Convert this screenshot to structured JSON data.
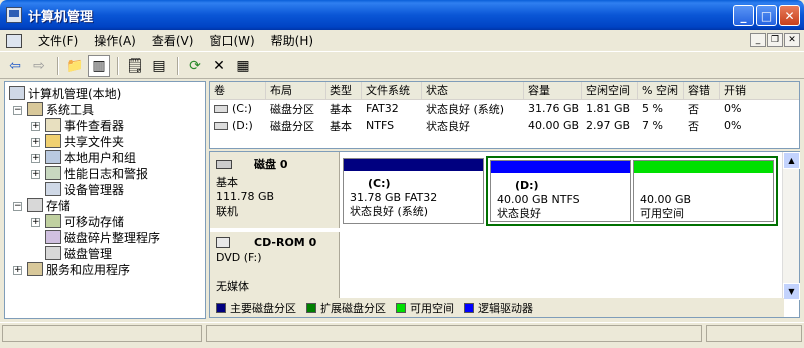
{
  "window": {
    "title": "计算机管理"
  },
  "menu": [
    "文件(F)",
    "操作(A)",
    "查看(V)",
    "窗口(W)",
    "帮助(H)"
  ],
  "tree": {
    "root": "计算机管理(本地)",
    "system_tools": "系统工具",
    "event_viewer": "事件查看器",
    "shared_folders": "共享文件夹",
    "local_users": "本地用户和组",
    "perf_logs": "性能日志和警报",
    "device_manager": "设备管理器",
    "storage": "存储",
    "removable": "可移动存储",
    "defrag": "磁盘碎片整理程序",
    "disk_mgmt": "磁盘管理",
    "services": "服务和应用程序"
  },
  "list": {
    "columns": [
      "卷",
      "布局",
      "类型",
      "文件系统",
      "状态",
      "容量",
      "空闲空间",
      "% 空闲",
      "容错",
      "开销"
    ],
    "rows": [
      [
        "(C:)",
        "磁盘分区",
        "基本",
        "FAT32",
        "状态良好 (系统)",
        "31.76 GB",
        "1.81 GB",
        "5 %",
        "否",
        "0%"
      ],
      [
        "(D:)",
        "磁盘分区",
        "基本",
        "NTFS",
        "状态良好",
        "40.00 GB",
        "2.97 GB",
        "7 %",
        "否",
        "0%"
      ]
    ]
  },
  "disk0": {
    "name": "磁盘 0",
    "type": "基本",
    "size": "111.78 GB",
    "status": "联机",
    "partitions": [
      {
        "label": "(C:)",
        "detail": "31.78 GB FAT32",
        "status": "状态良好 (系统)",
        "color": "#000080"
      },
      {
        "label": "(D:)",
        "detail": "40.00 GB NTFS",
        "status": "状态良好",
        "color": "#0000ff"
      },
      {
        "label": "",
        "detail": "40.00 GB",
        "status": "可用空间",
        "color": "#00e000"
      }
    ]
  },
  "cdrom0": {
    "name": "CD-ROM 0",
    "type": "DVD (F:)",
    "status": "无媒体"
  },
  "legend": [
    {
      "label": "主要磁盘分区",
      "color": "#000080"
    },
    {
      "label": "扩展磁盘分区",
      "color": "#008000"
    },
    {
      "label": "可用空间",
      "color": "#00e000"
    },
    {
      "label": "逻辑驱动器",
      "color": "#0000ff"
    }
  ]
}
